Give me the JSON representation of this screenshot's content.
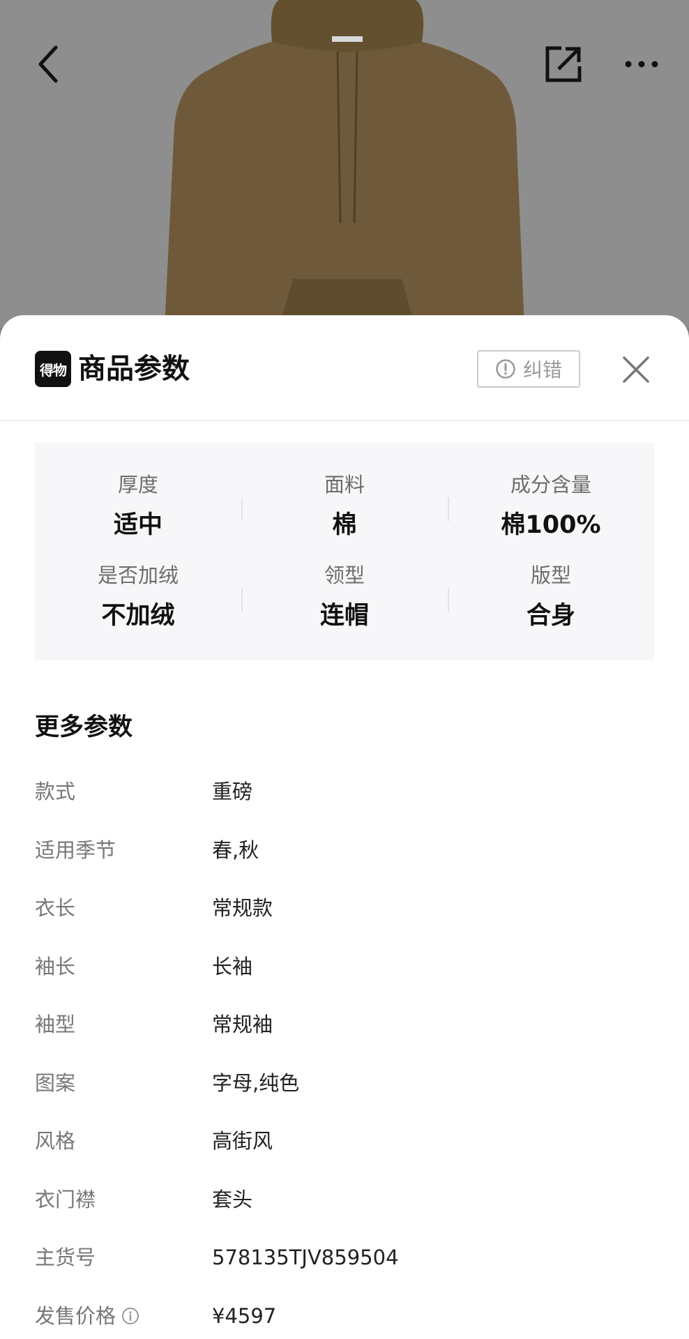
{
  "header": {
    "logo_text": "得物",
    "title": "商品参数",
    "correct_label": "纠错"
  },
  "icons": {
    "back": "chevron-left-icon",
    "share": "share-external-icon",
    "more": "more-horizontal-icon",
    "close": "close-icon",
    "alert": "alert-circle-icon",
    "info": "info-circle-icon"
  },
  "key_params": [
    {
      "label": "厚度",
      "value": "适中"
    },
    {
      "label": "面料",
      "value": "棉"
    },
    {
      "label": "成分含量",
      "value": "棉100%"
    },
    {
      "label": "是否加绒",
      "value": "不加绒"
    },
    {
      "label": "领型",
      "value": "连帽"
    },
    {
      "label": "版型",
      "value": "合身"
    }
  ],
  "more": {
    "title": "更多参数",
    "rows": [
      {
        "label": "款式",
        "value": "重磅"
      },
      {
        "label": "适用季节",
        "value": "春,秋"
      },
      {
        "label": "衣长",
        "value": "常规款"
      },
      {
        "label": "袖长",
        "value": "长袖"
      },
      {
        "label": "袖型",
        "value": "常规袖"
      },
      {
        "label": "图案",
        "value": "字母,纯色"
      },
      {
        "label": "风格",
        "value": "高街风"
      },
      {
        "label": "衣门襟",
        "value": "套头"
      },
      {
        "label": "主货号",
        "value": "578135TJV859504"
      },
      {
        "label": "发售价格",
        "value": "¥4597"
      }
    ]
  },
  "colors": {
    "hoodie": "#8a7148",
    "overlay_bg": "#8e8e8e",
    "sheet_bg": "#ffffff",
    "grid_bg": "#f7f7f9"
  }
}
